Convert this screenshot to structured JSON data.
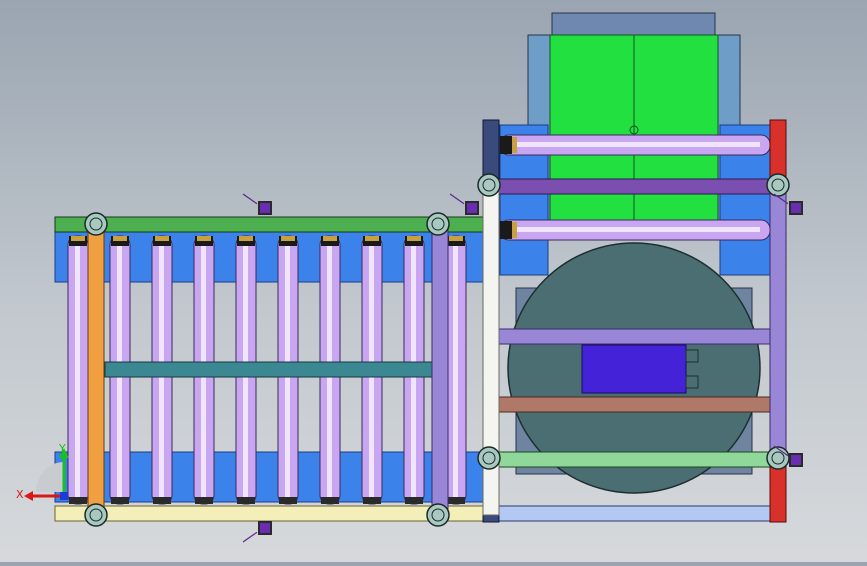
{
  "viewport": {
    "background_top": "#9aa5b1",
    "background_bottom": "#d6d9dc"
  },
  "colors": {
    "roller": "#c9a6f2",
    "roller_highlight": "#f1e4ff",
    "roller_cap": "#1a1a1a",
    "frame_green": "#4caf50",
    "frame_cream": "#f4efb9",
    "frame_orange": "#f0a040",
    "frame_purple": "#9a86d6",
    "frame_violet": "#7a4fb0",
    "frame_red": "#d8302a",
    "frame_navy": "#3a4a7a",
    "frame_teal": "#3b8792",
    "frame_brown": "#b07868",
    "frame_lightblue": "#b3c8f2",
    "frame_lightgreen": "#8fd89a",
    "plate_blue": "#3b82ea",
    "plate_lightblue": "#5aa6e6",
    "motor_green": "#22e040",
    "motor_slate": "#6e88b0",
    "drum_teal": "#4a6e72",
    "gearbox": "#4422d8",
    "caster": "#a8c8c0",
    "sensor": "#6a2cb0"
  },
  "icons": {
    "axis_triad": "axis-triad-icon",
    "caster": "caster-wheel-icon",
    "sensor": "sensor-bracket-icon"
  },
  "axis": {
    "x_label": "X",
    "y_label": "Y"
  },
  "conveyor": {
    "left_roller_count": 9,
    "right_roller_count": 2
  }
}
